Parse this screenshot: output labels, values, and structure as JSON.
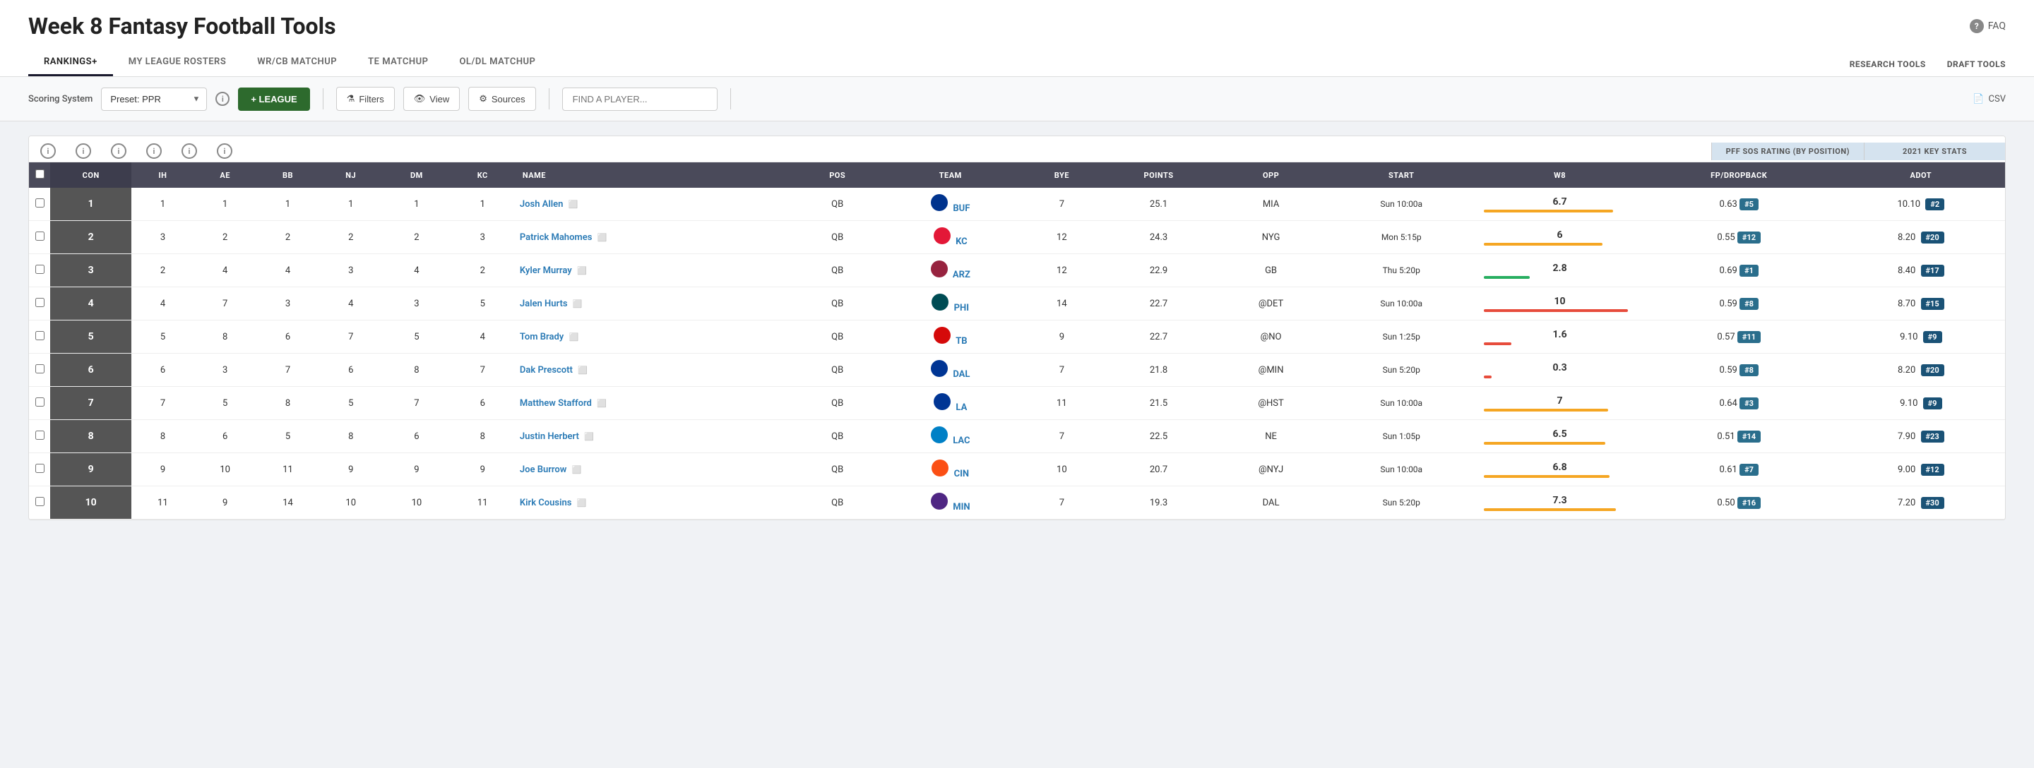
{
  "header": {
    "title": "Week 8 Fantasy Football Tools",
    "faq": "FAQ"
  },
  "nav": {
    "tabs": [
      {
        "id": "rankings",
        "label": "RANKINGS+",
        "active": true
      },
      {
        "id": "rosters",
        "label": "MY LEAGUE ROSTERS",
        "active": false
      },
      {
        "id": "wr_cb",
        "label": "WR/CB MATCHUP",
        "active": false
      },
      {
        "id": "te",
        "label": "TE MATCHUP",
        "active": false
      },
      {
        "id": "ol_dl",
        "label": "OL/DL MATCHUP",
        "active": false
      }
    ],
    "right_links": [
      {
        "id": "research",
        "label": "RESEARCH TOOLS"
      },
      {
        "id": "draft",
        "label": "DRAFT TOOLS"
      }
    ]
  },
  "toolbar": {
    "scoring_label": "Scoring System",
    "preset_label": "Preset: PPR",
    "league_btn": "+ LEAGUE",
    "filters_btn": "Filters",
    "view_btn": "View",
    "sources_btn": "Sources",
    "search_placeholder": "FIND A PLAYER...",
    "csv_btn": "CSV"
  },
  "table": {
    "info_group_label": "PFF SOS RATING (BY POSITION)",
    "stats_group_label": "2021 KEY STATS",
    "columns": {
      "checkbox": "",
      "con": "CON",
      "ih": "IH",
      "ae": "AE",
      "bb": "BB",
      "nj": "NJ",
      "dm": "DM",
      "kc": "KC",
      "name": "NAME",
      "pos": "POS",
      "team": "TEAM",
      "bye": "BYE",
      "points": "POINTS",
      "opp": "OPP",
      "start": "START",
      "w8": "W8",
      "fp_dropback": "FP/DROPBACK",
      "adot": "ADOT"
    },
    "rows": [
      {
        "rank": "1",
        "con": "1",
        "ih": "1",
        "ae": "1",
        "bb": "1",
        "nj": "1",
        "kc": "1",
        "name": "Josh Allen",
        "pos": "QB",
        "team": "BUF",
        "bye": "7",
        "points": "25.1",
        "opp": "MIA",
        "start": "Sun 10:00a",
        "w8": "6.7",
        "w8_color": "#f5a623",
        "w8_bar_width": 85,
        "fp_dropback": "0.63",
        "fp_rank": "#5",
        "fp_rank_color": "#2a6e8c",
        "adot": "10.10",
        "adot_rank": "#2",
        "adot_rank_color": "#1a5276"
      },
      {
        "rank": "2",
        "con": "3",
        "ih": "2",
        "ae": "2",
        "bb": "2",
        "nj": "2",
        "kc": "3",
        "name": "Patrick Mahomes",
        "pos": "QB",
        "team": "KC",
        "bye": "12",
        "points": "24.3",
        "opp": "NYG",
        "start": "Mon 5:15p",
        "w8": "6",
        "w8_color": "#f5a623",
        "w8_bar_width": 78,
        "fp_dropback": "0.55",
        "fp_rank": "#12",
        "fp_rank_color": "#2a6e8c",
        "adot": "8.20",
        "adot_rank": "#20",
        "adot_rank_color": "#1a5276"
      },
      {
        "rank": "3",
        "con": "2",
        "ih": "4",
        "ae": "4",
        "bb": "3",
        "nj": "4",
        "kc": "2",
        "name": "Kyler Murray",
        "pos": "QB",
        "team": "ARZ",
        "bye": "12",
        "points": "22.9",
        "opp": "GB",
        "start": "Thu 5:20p",
        "w8": "2.8",
        "w8_color": "#27ae60",
        "w8_bar_width": 30,
        "fp_dropback": "0.69",
        "fp_rank": "#1",
        "fp_rank_color": "#2a6e8c",
        "adot": "8.40",
        "adot_rank": "#17",
        "adot_rank_color": "#1a5276"
      },
      {
        "rank": "4",
        "con": "4",
        "ih": "7",
        "ae": "3",
        "bb": "4",
        "nj": "3",
        "kc": "5",
        "name": "Jalen Hurts",
        "pos": "QB",
        "team": "PHI",
        "bye": "14",
        "points": "22.7",
        "opp": "@DET",
        "start": "Sun 10:00a",
        "w8": "10",
        "w8_color": "#e74c3c",
        "w8_bar_width": 95,
        "fp_dropback": "0.59",
        "fp_rank": "#8",
        "fp_rank_color": "#2a6e8c",
        "adot": "8.70",
        "adot_rank": "#15",
        "adot_rank_color": "#1a5276"
      },
      {
        "rank": "5",
        "con": "5",
        "ih": "8",
        "ae": "6",
        "bb": "7",
        "nj": "5",
        "kc": "4",
        "name": "Tom Brady",
        "pos": "QB",
        "team": "TB",
        "bye": "9",
        "points": "22.7",
        "opp": "@NO",
        "start": "Sun 1:25p",
        "w8": "1.6",
        "w8_color": "#e74c3c",
        "w8_bar_width": 18,
        "fp_dropback": "0.57",
        "fp_rank": "#11",
        "fp_rank_color": "#2a6e8c",
        "adot": "9.10",
        "adot_rank": "#9",
        "adot_rank_color": "#1a5276"
      },
      {
        "rank": "6",
        "con": "6",
        "ih": "3",
        "ae": "7",
        "bb": "6",
        "nj": "8",
        "kc": "7",
        "name": "Dak Prescott",
        "pos": "QB",
        "team": "DAL",
        "bye": "7",
        "points": "21.8",
        "opp": "@MIN",
        "start": "Sun 5:20p",
        "w8": "0.3",
        "w8_color": "#e74c3c",
        "w8_bar_width": 5,
        "fp_dropback": "0.59",
        "fp_rank": "#8",
        "fp_rank_color": "#2a6e8c",
        "adot": "8.20",
        "adot_rank": "#20",
        "adot_rank_color": "#1a5276"
      },
      {
        "rank": "7",
        "con": "7",
        "ih": "5",
        "ae": "8",
        "bb": "5",
        "nj": "7",
        "kc": "6",
        "name": "Matthew Stafford",
        "pos": "QB",
        "team": "LA",
        "bye": "11",
        "points": "21.5",
        "opp": "@HST",
        "start": "Sun 10:00a",
        "w8": "7",
        "w8_color": "#f5a623",
        "w8_bar_width": 82,
        "fp_dropback": "0.64",
        "fp_rank": "#3",
        "fp_rank_color": "#2a6e8c",
        "adot": "9.10",
        "adot_rank": "#9",
        "adot_rank_color": "#1a5276"
      },
      {
        "rank": "8",
        "con": "8",
        "ih": "6",
        "ae": "5",
        "bb": "8",
        "nj": "6",
        "kc": "8",
        "name": "Justin Herbert",
        "pos": "QB",
        "team": "LAC",
        "bye": "7",
        "points": "22.5",
        "opp": "NE",
        "start": "Sun 1:05p",
        "w8": "6.5",
        "w8_color": "#f5a623",
        "w8_bar_width": 80,
        "fp_dropback": "0.51",
        "fp_rank": "#14",
        "fp_rank_color": "#2a6e8c",
        "adot": "7.90",
        "adot_rank": "#23",
        "adot_rank_color": "#1a5276"
      },
      {
        "rank": "9",
        "con": "9",
        "ih": "10",
        "ae": "11",
        "bb": "9",
        "nj": "9",
        "kc": "9",
        "name": "Joe Burrow",
        "pos": "QB",
        "team": "CIN",
        "bye": "10",
        "points": "20.7",
        "opp": "@NYJ",
        "start": "Sun 10:00a",
        "w8": "6.8",
        "w8_color": "#f5a623",
        "w8_bar_width": 83,
        "fp_dropback": "0.61",
        "fp_rank": "#7",
        "fp_rank_color": "#2a6e8c",
        "adot": "9.00",
        "adot_rank": "#12",
        "adot_rank_color": "#1a5276"
      },
      {
        "rank": "10",
        "con": "11",
        "ih": "9",
        "ae": "14",
        "bb": "10",
        "nj": "10",
        "kc": "11",
        "name": "Kirk Cousins",
        "pos": "QB",
        "team": "MIN",
        "bye": "7",
        "points": "19.3",
        "opp": "DAL",
        "start": "Sun 5:20p",
        "w8": "7.3",
        "w8_color": "#f5a623",
        "w8_bar_width": 87,
        "fp_dropback": "0.50",
        "fp_rank": "#16",
        "fp_rank_color": "#2a6e8c",
        "adot": "7.20",
        "adot_rank": "#30",
        "adot_rank_color": "#1a5276"
      }
    ],
    "team_colors": {
      "BUF": {
        "bg": "#00338d",
        "text": "#fff"
      },
      "KC": {
        "bg": "#e31837",
        "text": "#fff"
      },
      "ARZ": {
        "bg": "#97233f",
        "text": "#fff"
      },
      "PHI": {
        "bg": "#004c54",
        "text": "#fff"
      },
      "TB": {
        "bg": "#d50a0a",
        "text": "#fff"
      },
      "DAL": {
        "bg": "#003594",
        "text": "#fff"
      },
      "LA": {
        "bg": "#003594",
        "text": "#fff"
      },
      "LAC": {
        "bg": "#0080c6",
        "text": "#fff"
      },
      "CIN": {
        "bg": "#fb4f14",
        "text": "#fff"
      },
      "MIN": {
        "bg": "#4f2683",
        "text": "#fff"
      }
    }
  }
}
